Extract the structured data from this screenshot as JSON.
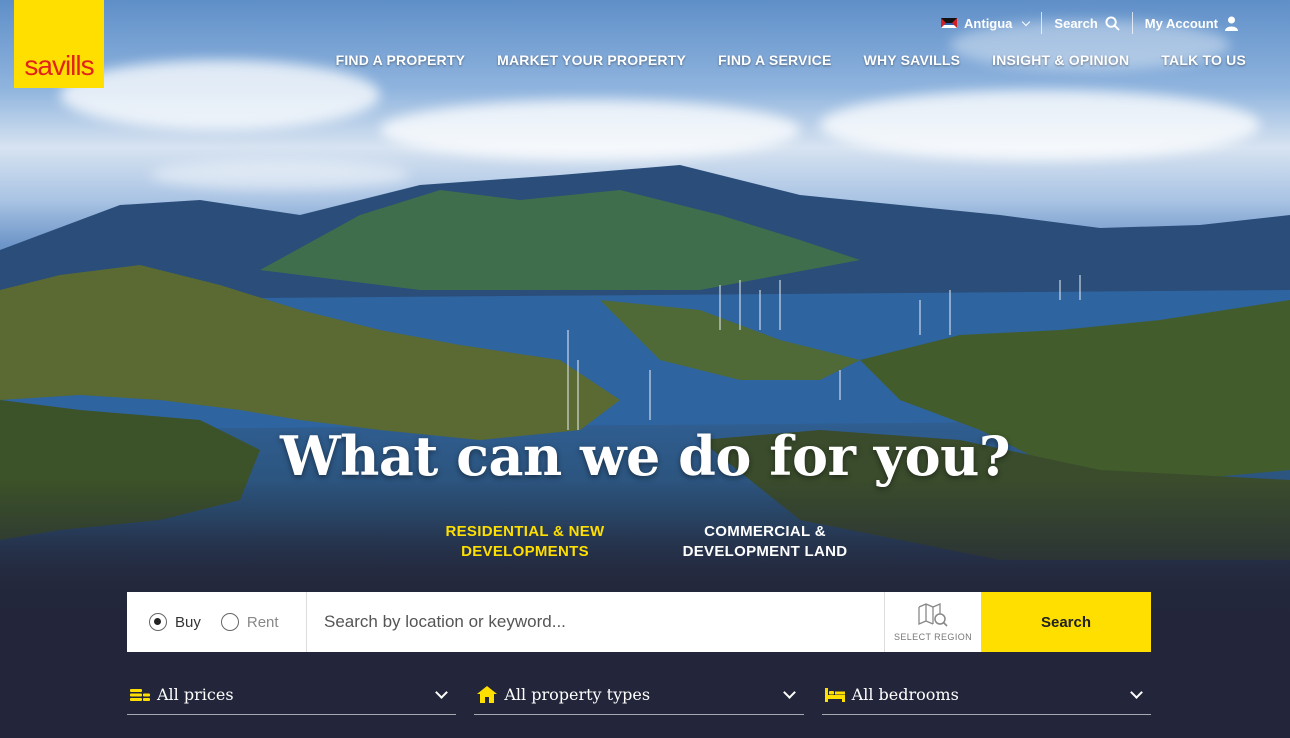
{
  "brand": {
    "logo_text": "savills",
    "logo_color": "#ffdf00",
    "accent_color": "#e2231a"
  },
  "utility": {
    "country": "Antigua",
    "search_label": "Search",
    "account_label": "My Account"
  },
  "nav": {
    "items": [
      "FIND A PROPERTY",
      "MARKET YOUR PROPERTY",
      "FIND A SERVICE",
      "WHY SAVILLS",
      "INSIGHT & OPINION",
      "TALK TO US"
    ]
  },
  "hero": {
    "headline": "What can we do for you?",
    "tabs": {
      "residential": "RESIDENTIAL & NEW DEVELOPMENTS",
      "commercial": "COMMERCIAL & DEVELOPMENT LAND"
    },
    "active_tab_color": "#ffdf00"
  },
  "search": {
    "buy_label": "Buy",
    "rent_label": "Rent",
    "selected_mode": "Buy",
    "placeholder": "Search by location or keyword...",
    "region_label": "SELECT REGION",
    "button_label": "Search"
  },
  "filters": {
    "prices": "All prices",
    "property_types": "All property types",
    "bedrooms": "All bedrooms"
  },
  "icons": [
    "flag-antigua-icon",
    "chevron-down-icon",
    "search-icon",
    "user-icon",
    "map-search-icon",
    "coins-icon",
    "house-icon",
    "bed-icon"
  ]
}
